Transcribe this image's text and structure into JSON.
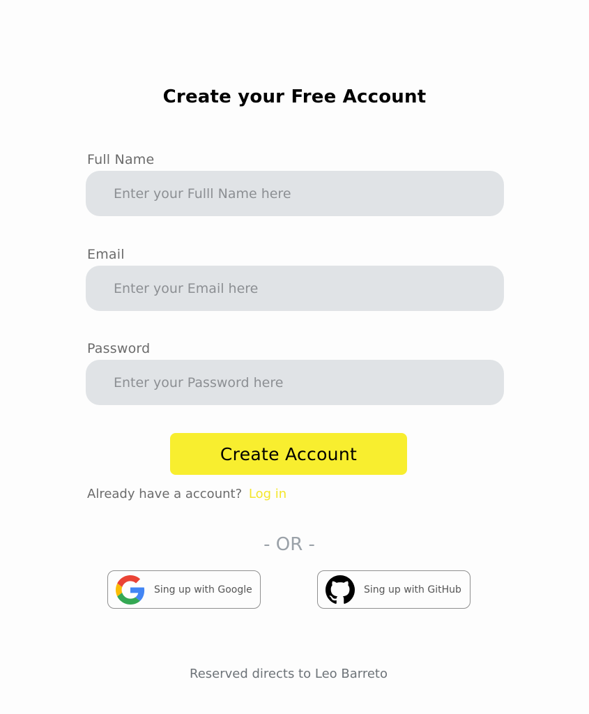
{
  "page": {
    "title": "Create your Free Account"
  },
  "form": {
    "full_name": {
      "label": "Full Name",
      "placeholder": "Enter your Fulll Name here",
      "value": ""
    },
    "email": {
      "label": "Email",
      "placeholder": "Enter your Email here",
      "value": ""
    },
    "password": {
      "label": "Password",
      "placeholder": "Enter your Password here",
      "value": ""
    },
    "submit_label": "Create Account"
  },
  "login_prompt": {
    "text": "Already have a account?",
    "link_label": "Log in"
  },
  "divider": {
    "text": "- OR -"
  },
  "social": {
    "google": {
      "label": "Sing up with Google",
      "icon": "google-icon"
    },
    "github": {
      "label": "Sing up with GitHub",
      "icon": "github-icon"
    }
  },
  "footer": {
    "text": "Reserved directs to Leo Barreto"
  },
  "colors": {
    "accent": "#f8ee2f",
    "link": "#f4e62a",
    "input_bg": "#e0e3e6",
    "page_bg": "#fdfdfd"
  }
}
